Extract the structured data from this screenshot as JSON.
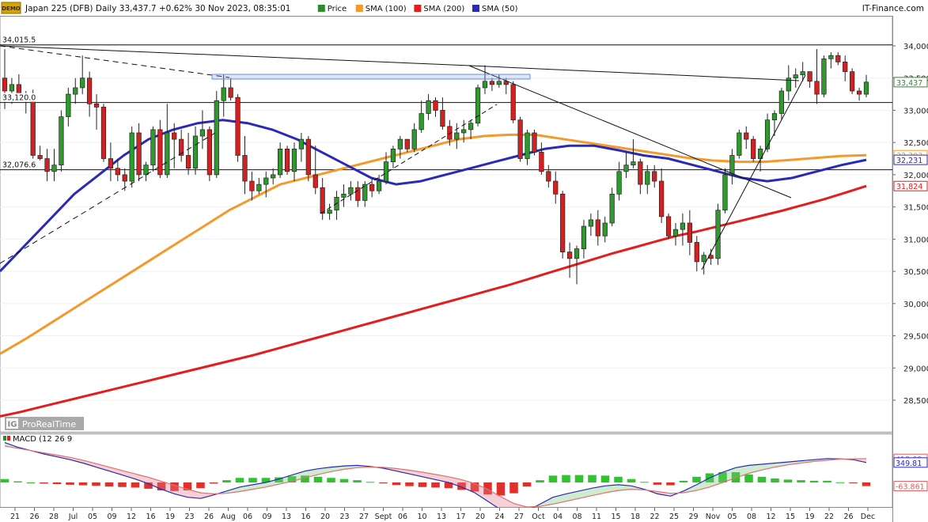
{
  "header": {
    "demo_badge": "DEMO",
    "title": "Japan 225 (DFB) Daily 33,437.7 +0.62% 30 Nov 2023, 08:35:01",
    "legend": [
      {
        "label": "Price",
        "color": "#2e8b2e"
      },
      {
        "label": "SMA (100)",
        "color": "#f39a2b"
      },
      {
        "label": "SMA (200)",
        "color": "#e51c1c"
      },
      {
        "label": "SMA (50)",
        "color": "#2a2ab8"
      }
    ],
    "source": "IT-Finance.com"
  },
  "watermark": {
    "text": "ProRealTime"
  },
  "chart_data": [
    {
      "type": "candlestick",
      "title": "Japan 225 (DFB) Daily",
      "y_range": [
        28200,
        34100
      ],
      "y_ticks": [
        "34,000",
        "33,500",
        "33,000",
        "32,500",
        "32,000",
        "31,500",
        "31,000",
        "30,500",
        "30,000",
        "29,500",
        "29,000",
        "28,500"
      ],
      "y_tick_values": [
        34000,
        33500,
        33000,
        32500,
        32000,
        31500,
        31000,
        30500,
        30000,
        29500,
        29000,
        28500
      ],
      "x_tick_labels": [
        "21",
        "26",
        "28",
        "Jul",
        "05",
        "09",
        "12",
        "16",
        "19",
        "23",
        "26",
        "Aug",
        "06",
        "09",
        "13",
        "16",
        "20",
        "23",
        "27",
        "Sept",
        "06",
        "10",
        "13",
        "17",
        "20",
        "24",
        "27",
        "Oct",
        "04",
        "08",
        "11",
        "15",
        "18",
        "22",
        "25",
        "29",
        "Nov",
        "05",
        "08",
        "12",
        "15",
        "19",
        "22",
        "26",
        "Dec"
      ],
      "horizontal_levels": [
        {
          "label": "34,015.5",
          "value": 34015.5
        },
        {
          "label": "33,120.0",
          "value": 33120
        },
        {
          "label": "32,076.6",
          "value": 32076.6
        }
      ],
      "value_tags": [
        {
          "label": "33,437",
          "value": 33437,
          "color": "#2e8b2e"
        },
        {
          "label": "32,303",
          "value": 32303,
          "color": "#f39a2b"
        },
        {
          "label": "32,231",
          "value": 32231,
          "color": "#2a2ab8"
        },
        {
          "label": "31,824",
          "value": 31824,
          "color": "#e51c1c"
        }
      ],
      "ohlc": [
        [
          33500,
          33950,
          33020,
          33300
        ],
        [
          33300,
          33500,
          33100,
          33400
        ],
        [
          33400,
          33560,
          33180,
          33250
        ],
        [
          33250,
          33300,
          32950,
          33200
        ],
        [
          33200,
          33320,
          32250,
          32300
        ],
        [
          32300,
          32450,
          32100,
          32250
        ],
        [
          32250,
          32400,
          31900,
          32050
        ],
        [
          32050,
          32400,
          31900,
          32150
        ],
        [
          32150,
          33000,
          32050,
          32900
        ],
        [
          32900,
          33350,
          32750,
          33250
        ],
        [
          33250,
          33500,
          33100,
          33350
        ],
        [
          33350,
          33850,
          33250,
          33500
        ],
        [
          33500,
          33600,
          32900,
          33100
        ],
        [
          33100,
          33250,
          32700,
          33050
        ],
        [
          33050,
          33100,
          32200,
          32250
        ],
        [
          32250,
          32500,
          31900,
          32100
        ],
        [
          32100,
          32250,
          31900,
          32000
        ],
        [
          32000,
          32100,
          31750,
          31900
        ],
        [
          31900,
          32750,
          31800,
          32650
        ],
        [
          32650,
          32800,
          31900,
          32000
        ],
        [
          32000,
          32200,
          31900,
          32150
        ],
        [
          32150,
          32750,
          32050,
          32700
        ],
        [
          32700,
          32850,
          31950,
          32000
        ],
        [
          32000,
          33100,
          31950,
          32650
        ],
        [
          32650,
          32800,
          32100,
          32550
        ],
        [
          32550,
          32700,
          32200,
          32300
        ],
        [
          32300,
          32650,
          32000,
          32100
        ],
        [
          32100,
          32750,
          32000,
          32600
        ],
        [
          32600,
          33000,
          32400,
          32700
        ],
        [
          32700,
          32750,
          31900,
          32000
        ],
        [
          32000,
          33300,
          31950,
          33150
        ],
        [
          33150,
          33550,
          32900,
          33350
        ],
        [
          33350,
          33500,
          33150,
          33200
        ],
        [
          33200,
          33250,
          32200,
          32300
        ],
        [
          32300,
          32600,
          31700,
          31900
        ],
        [
          31900,
          32050,
          31600,
          31750
        ],
        [
          31750,
          31950,
          31700,
          31850
        ],
        [
          31850,
          32050,
          31650,
          31950
        ],
        [
          31950,
          32100,
          31850,
          32000
        ],
        [
          32000,
          32500,
          31950,
          32400
        ],
        [
          32400,
          32450,
          32000,
          32050
        ],
        [
          32050,
          32500,
          31900,
          32400
        ],
        [
          32400,
          32650,
          32200,
          32550
        ],
        [
          32550,
          32600,
          31900,
          32000
        ],
        [
          32000,
          32450,
          31700,
          31800
        ],
        [
          31800,
          31950,
          31300,
          31400
        ],
        [
          31400,
          31550,
          31300,
          31450
        ],
        [
          31450,
          31750,
          31300,
          31650
        ],
        [
          31650,
          31850,
          31500,
          31700
        ],
        [
          31700,
          31900,
          31600,
          31800
        ],
        [
          31800,
          31900,
          31500,
          31600
        ],
        [
          31600,
          31900,
          31500,
          31850
        ],
        [
          31850,
          31950,
          31650,
          31750
        ],
        [
          31750,
          32000,
          31700,
          31900
        ],
        [
          31900,
          32350,
          31850,
          32200
        ],
        [
          32200,
          32450,
          32100,
          32400
        ],
        [
          32400,
          32600,
          32250,
          32550
        ],
        [
          32550,
          32550,
          32350,
          32400
        ],
        [
          32400,
          32800,
          32350,
          32700
        ],
        [
          32700,
          33150,
          32650,
          32950
        ],
        [
          32950,
          33250,
          32850,
          33150
        ],
        [
          33150,
          33200,
          32900,
          33000
        ],
        [
          33000,
          33200,
          32700,
          32750
        ],
        [
          32750,
          32850,
          32450,
          32550
        ],
        [
          32550,
          32800,
          32400,
          32650
        ],
        [
          32650,
          32850,
          32500,
          32700
        ],
        [
          32700,
          32850,
          32550,
          32800
        ],
        [
          32800,
          33400,
          32750,
          33350
        ],
        [
          33350,
          33700,
          33250,
          33450
        ],
        [
          33450,
          33500,
          33300,
          33400
        ],
        [
          33400,
          33550,
          33350,
          33450
        ],
        [
          33450,
          33500,
          33250,
          33400
        ],
        [
          33400,
          33450,
          32800,
          32850
        ],
        [
          32850,
          32900,
          32200,
          32250
        ],
        [
          32250,
          32700,
          32150,
          32650
        ],
        [
          32650,
          32700,
          32300,
          32350
        ],
        [
          32350,
          32500,
          32000,
          32050
        ],
        [
          32050,
          32150,
          31800,
          31900
        ],
        [
          31900,
          32050,
          31550,
          31700
        ],
        [
          31700,
          31750,
          30700,
          30800
        ],
        [
          30800,
          30950,
          30400,
          30700
        ],
        [
          30700,
          30900,
          30300,
          30850
        ],
        [
          30850,
          31300,
          30700,
          31200
        ],
        [
          31200,
          31400,
          31050,
          31300
        ],
        [
          31300,
          31450,
          30900,
          31050
        ],
        [
          31050,
          31350,
          30950,
          31250
        ],
        [
          31250,
          31800,
          31200,
          31700
        ],
        [
          31700,
          32200,
          31600,
          32050
        ],
        [
          32050,
          32350,
          31950,
          32150
        ],
        [
          32150,
          32550,
          32100,
          32200
        ],
        [
          32200,
          32250,
          31700,
          31850
        ],
        [
          31850,
          32150,
          31700,
          32050
        ],
        [
          32050,
          32150,
          31800,
          31900
        ],
        [
          31900,
          32100,
          31250,
          31350
        ],
        [
          31350,
          31400,
          31000,
          31050
        ],
        [
          31050,
          31250,
          30900,
          31150
        ],
        [
          31150,
          31400,
          30900,
          31250
        ],
        [
          31250,
          31450,
          30750,
          30950
        ],
        [
          30950,
          31050,
          30500,
          30650
        ],
        [
          30650,
          30800,
          30450,
          30750
        ],
        [
          30750,
          30850,
          30600,
          30700
        ],
        [
          30700,
          31550,
          30600,
          31450
        ],
        [
          31450,
          32100,
          31400,
          32000
        ],
        [
          32000,
          32400,
          31850,
          32300
        ],
        [
          32300,
          32700,
          32250,
          32650
        ],
        [
          32650,
          32750,
          32400,
          32550
        ],
        [
          32550,
          32600,
          32200,
          32250
        ],
        [
          32250,
          32450,
          32050,
          32400
        ],
        [
          32400,
          32950,
          32350,
          32850
        ],
        [
          32850,
          33000,
          32600,
          32950
        ],
        [
          32950,
          33350,
          32850,
          33300
        ],
        [
          33300,
          33700,
          33150,
          33500
        ],
        [
          33500,
          33650,
          33350,
          33550
        ],
        [
          33550,
          33750,
          33450,
          33600
        ],
        [
          33600,
          33600,
          33350,
          33450
        ],
        [
          33450,
          33950,
          33100,
          33250
        ],
        [
          33250,
          33850,
          33200,
          33800
        ],
        [
          33800,
          33900,
          33650,
          33850
        ],
        [
          33850,
          33900,
          33700,
          33750
        ],
        [
          33750,
          33850,
          33450,
          33600
        ],
        [
          33600,
          33650,
          33250,
          33300
        ],
        [
          33300,
          33350,
          33150,
          33250
        ],
        [
          33250,
          33550,
          33200,
          33437.7
        ]
      ],
      "sma_200": {
        "name": "SMA (200)",
        "color": "#e51c1c",
        "values": [
          28250,
          28320,
          28400,
          28480,
          28560,
          28640,
          28720,
          28800,
          28880,
          28960,
          29040,
          29120,
          29200,
          29290,
          29380,
          29470,
          29560,
          29650,
          29740,
          29830,
          29920,
          30010,
          30100,
          30190,
          30280,
          30380,
          30480,
          30580,
          30680,
          30780,
          30870,
          30960,
          31050,
          31120,
          31200,
          31280,
          31360,
          31440,
          31530,
          31620,
          31720,
          31824
        ]
      },
      "sma_100": {
        "name": "SMA (100)",
        "color": "#f39a2b",
        "values": [
          29220,
          29450,
          29700,
          29950,
          30200,
          30450,
          30700,
          30950,
          31200,
          31450,
          31650,
          31850,
          31950,
          32050,
          32150,
          32250,
          32350,
          32450,
          32550,
          32600,
          32620,
          32620,
          32560,
          32500,
          32440,
          32380,
          32320,
          32260,
          32220,
          32200,
          32200,
          32230,
          32260,
          32290,
          32303
        ]
      },
      "sma_50": {
        "name": "SMA (50)",
        "color": "#2a2ab8",
        "values": [
          30500,
          30900,
          31300,
          31700,
          32000,
          32300,
          32550,
          32700,
          32800,
          32850,
          32800,
          32700,
          32550,
          32350,
          32150,
          31950,
          31850,
          31900,
          32000,
          32100,
          32200,
          32300,
          32400,
          32450,
          32450,
          32380,
          32300,
          32250,
          32150,
          32050,
          31950,
          31900,
          31950,
          32050,
          32150,
          32231
        ]
      }
    },
    {
      "type": "macd",
      "title": "MACD (12 26 9",
      "y_ticks": [
        "413.68",
        "349.81",
        "-63.861"
      ],
      "y_tick_values": [
        413.68,
        349.81,
        -63.861
      ],
      "series": [
        {
          "name": "MACD",
          "color": "#2a2ab8",
          "values": [
            700,
            620,
            560,
            500,
            450,
            400,
            340,
            270,
            200,
            130,
            60,
            -20,
            -120,
            -200,
            -260,
            -280,
            -220,
            -150,
            -80,
            -40,
            0,
            60,
            130,
            200,
            240,
            270,
            290,
            300,
            280,
            250,
            200,
            150,
            100,
            50,
            0,
            -80,
            -180,
            -330,
            -480,
            -560,
            -500,
            -380,
            -260,
            -200,
            -150,
            -100,
            -60,
            -40,
            -60,
            -120,
            -200,
            -240,
            -150,
            -40,
            80,
            180,
            260,
            300,
            320,
            340,
            360,
            380,
            400,
            420,
            413.68,
            400,
            349.81
          ]
        },
        {
          "name": "Signal",
          "color": "#e07070",
          "values": [
            640,
            600,
            560,
            520,
            480,
            440,
            390,
            330,
            270,
            210,
            150,
            90,
            20,
            -50,
            -120,
            -180,
            -200,
            -190,
            -160,
            -120,
            -80,
            -30,
            20,
            80,
            140,
            190,
            230,
            260,
            270,
            265,
            245,
            215,
            180,
            140,
            100,
            50,
            -20,
            -120,
            -250,
            -370,
            -430,
            -420,
            -380,
            -330,
            -280,
            -230,
            -180,
            -140,
            -120,
            -130,
            -160,
            -190,
            -180,
            -140,
            -80,
            0,
            80,
            160,
            220,
            270,
            310,
            340,
            370,
            390,
            410,
            413.68,
            420
          ]
        }
      ],
      "histogram": [
        60,
        20,
        0,
        -20,
        -30,
        -40,
        -50,
        -60,
        -70,
        -80,
        -90,
        -110,
        -140,
        -150,
        -140,
        -100,
        -20,
        40,
        80,
        80,
        80,
        90,
        110,
        120,
        100,
        80,
        60,
        40,
        10,
        -15,
        -45,
        -65,
        -80,
        -90,
        -100,
        -130,
        -160,
        -210,
        -230,
        -190,
        -70,
        40,
        120,
        130,
        130,
        130,
        120,
        100,
        60,
        10,
        -40,
        -50,
        30,
        100,
        160,
        180,
        180,
        140,
        100,
        70,
        50,
        40,
        30,
        30,
        3,
        -13,
        -63.861
      ]
    }
  ]
}
